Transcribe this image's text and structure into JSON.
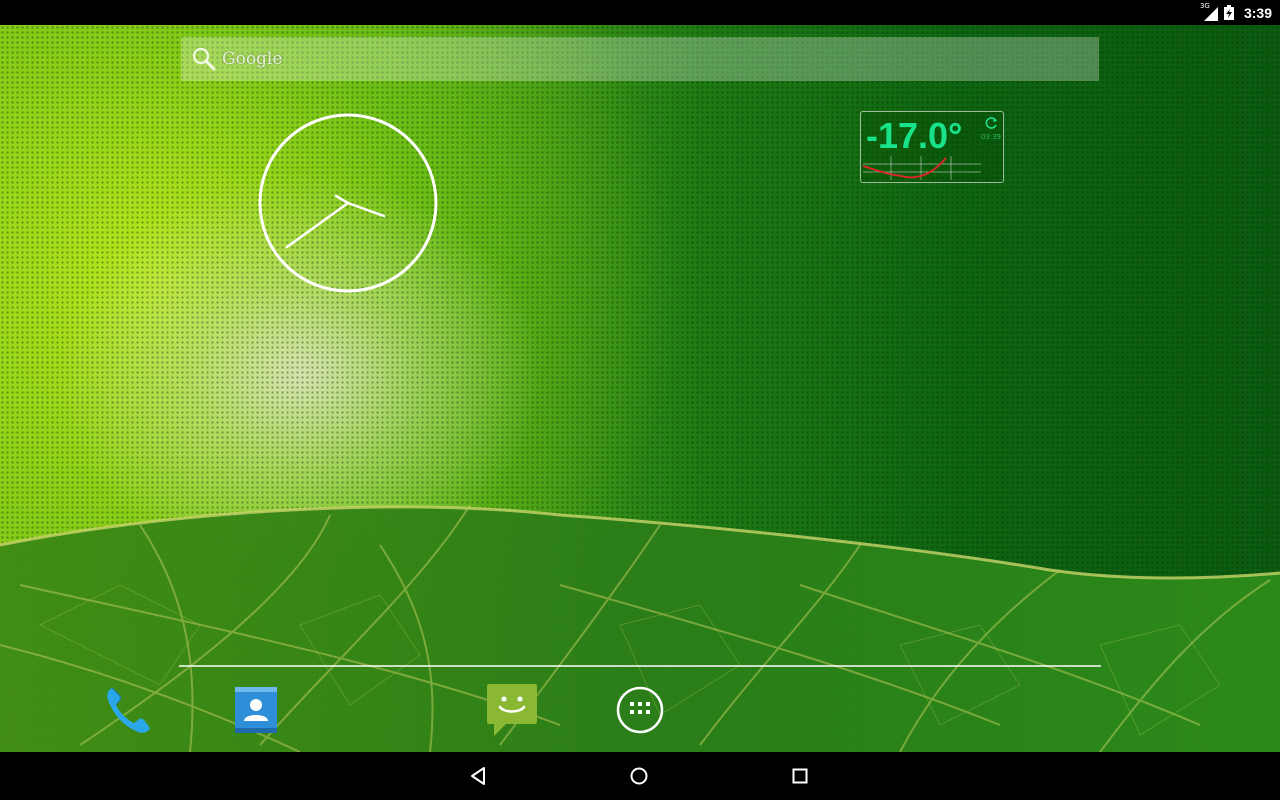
{
  "status_bar": {
    "network_type": "3G",
    "time": "3:39",
    "icons": [
      "signal-icon",
      "battery-charging-icon"
    ]
  },
  "search_widget": {
    "label": "Google",
    "icon": "search-icon"
  },
  "clock_widget": {
    "type": "analog",
    "time": "3:39"
  },
  "weather_widget": {
    "temperature": "-17.0°",
    "updated_time": "03:39",
    "icons": [
      "refresh-icon"
    ],
    "accent_color": "#19e38a"
  },
  "dock": {
    "items": [
      {
        "name": "Phone",
        "icon": "phone-icon"
      },
      {
        "name": "People",
        "icon": "contacts-icon"
      },
      {
        "name": "Messaging",
        "icon": "messaging-icon"
      },
      {
        "name": "Apps",
        "icon": "all-apps-icon"
      }
    ]
  },
  "nav_bar": {
    "buttons": [
      "back-icon",
      "home-icon",
      "recents-icon"
    ]
  },
  "colors": {
    "wallpaper_dark": "#0b5a10",
    "wallpaper_light": "#9ad01c"
  }
}
